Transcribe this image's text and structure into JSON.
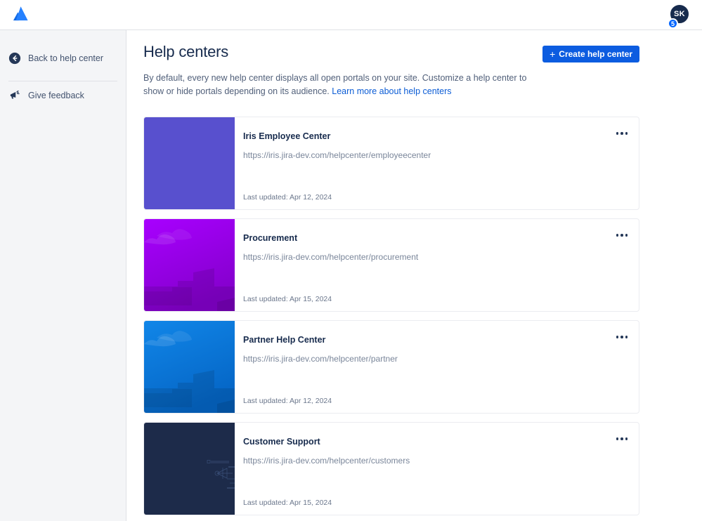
{
  "topbar": {
    "logo_icon": "atlassian-logo",
    "avatar_initials": "SK",
    "avatar_badge_count": "5"
  },
  "sidebar": {
    "items": [
      {
        "label": "Back to help center",
        "icon": "arrow-left-circle-icon"
      },
      {
        "label": "Give feedback",
        "icon": "megaphone-icon"
      }
    ]
  },
  "header": {
    "title": "Help centers",
    "create_button_label": "Create help center",
    "create_button_icon": "plus-icon",
    "description_text": "By default, every new help center displays all open portals on your site. Customize a help center to show or hide portals depending on its audience. ",
    "description_link": "Learn more about help centers"
  },
  "colors": {
    "accent_blue": "#0C5CE0",
    "link_blue": "#0B5CD5",
    "text_dark": "#172B4D",
    "text_muted": "#7A869A",
    "sidebar_bg": "#F4F5F7",
    "border": "#EBECF0"
  },
  "help_centers": [
    {
      "name": "Iris Employee Center",
      "url": "https://iris.jira-dev.com/helpcenter/employeecenter",
      "updated": "Last updated: Apr 12, 2024",
      "thumbnail_style": "flat",
      "thumbnail_color": "#5850CE",
      "menu_icon": "more-options-icon"
    },
    {
      "name": "Procurement",
      "url": "https://iris.jira-dev.com/helpcenter/procurement",
      "updated": "Last updated: Apr 15, 2024",
      "thumbnail_style": "cityscape",
      "thumbnail_color": "#9B00E8",
      "menu_icon": "more-options-icon"
    },
    {
      "name": "Partner Help Center",
      "url": "https://iris.jira-dev.com/helpcenter/partner",
      "updated": "Last updated: Apr 12, 2024",
      "thumbnail_style": "cityscape",
      "thumbnail_color": "#0B7CE0",
      "menu_icon": "more-options-icon"
    },
    {
      "name": "Customer Support",
      "url": "https://iris.jira-dev.com/helpcenter/customers",
      "updated": "Last updated: Apr 15, 2024",
      "thumbnail_style": "dark-tech",
      "thumbnail_color": "#1D2B4A",
      "menu_icon": "more-options-icon"
    }
  ]
}
